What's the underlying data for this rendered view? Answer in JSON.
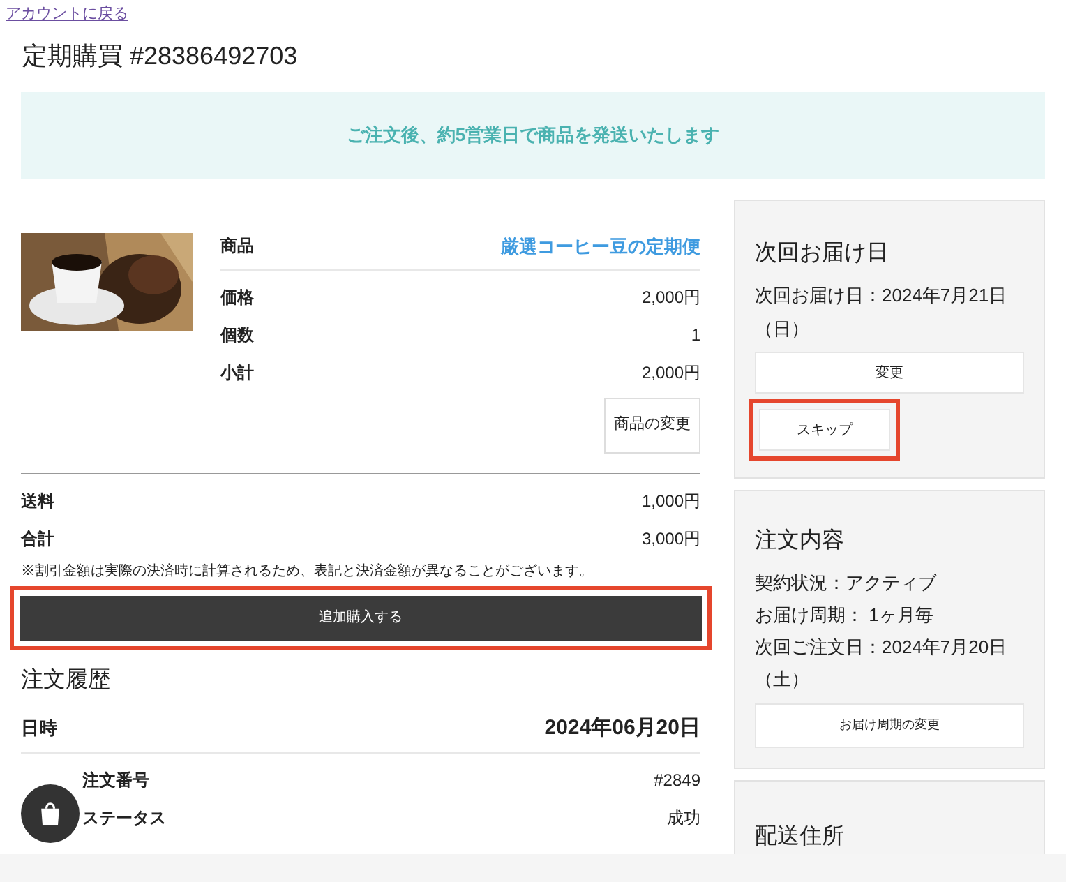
{
  "back_link": "アカウントに戻る",
  "title": "定期購買 #28386492703",
  "notice": "ご注文後、約5営業日で商品を発送いたします",
  "product": {
    "rows": [
      {
        "label": "商品",
        "value": "厳選コーヒー豆の定期便",
        "kind": "link"
      },
      {
        "label": "価格",
        "value": "2,000円",
        "kind": "plain"
      },
      {
        "label": "個数",
        "value": "1",
        "kind": "plain"
      },
      {
        "label": "小計",
        "value": "2,000円",
        "kind": "plain"
      }
    ],
    "change_button": "商品の変更"
  },
  "totals": [
    {
      "label": "送料",
      "value": "1,000円"
    },
    {
      "label": "合計",
      "value": "3,000円"
    }
  ],
  "note": "※割引金額は実際の決済時に計算されるため、表記と決済金額が異なることがございます。",
  "purchase_button": {
    "label": "追加購入する",
    "highlighted": true
  },
  "history": {
    "title": "注文履歴",
    "date_label": "日時",
    "date": "2024年06月20日",
    "rows": [
      {
        "label": "注文番号",
        "value": "#2849"
      },
      {
        "label": "ステータス",
        "value": "成功"
      }
    ]
  },
  "next_delivery": {
    "title": "次回お届け日",
    "text": "次回お届け日：2024年7月21日（日）",
    "buttons": [
      {
        "label": "変更",
        "highlighted": false
      },
      {
        "label": "スキップ",
        "highlighted": true
      }
    ]
  },
  "order_details": {
    "title": "注文内容",
    "lines": [
      "契約状況：アクティブ",
      "お届け周期： 1ヶ月毎",
      "次回ご注文日：2024年7月20日（土）"
    ],
    "button": "お届け周期の変更"
  },
  "address": {
    "title": "配送住所"
  }
}
